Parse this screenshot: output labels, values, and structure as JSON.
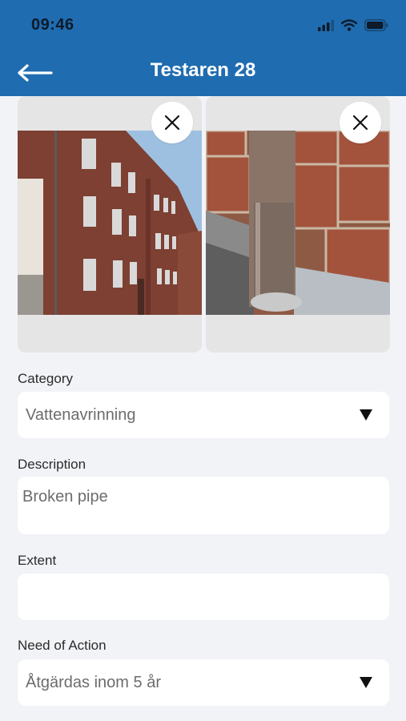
{
  "status_bar": {
    "time": "09:46"
  },
  "header": {
    "title": "Testaren 28"
  },
  "icons": {
    "back": "back-arrow-icon",
    "close": "close-icon",
    "dropdown": "triangle-down-icon"
  },
  "photos": [
    {
      "name": "building-facade-photo"
    },
    {
      "name": "drainpipe-brick-photo"
    }
  ],
  "form": {
    "category": {
      "label": "Category",
      "value": "Vattenavrinning"
    },
    "description": {
      "label": "Description",
      "value": "Broken pipe"
    },
    "extent": {
      "label": "Extent",
      "value": ""
    },
    "need_of_action": {
      "label": "Need of Action",
      "value": "Åtgärdas inom 5 år"
    }
  },
  "colors": {
    "header": "#1f6cb0",
    "background": "#f2f3f7",
    "card": "#e5e5e5"
  }
}
